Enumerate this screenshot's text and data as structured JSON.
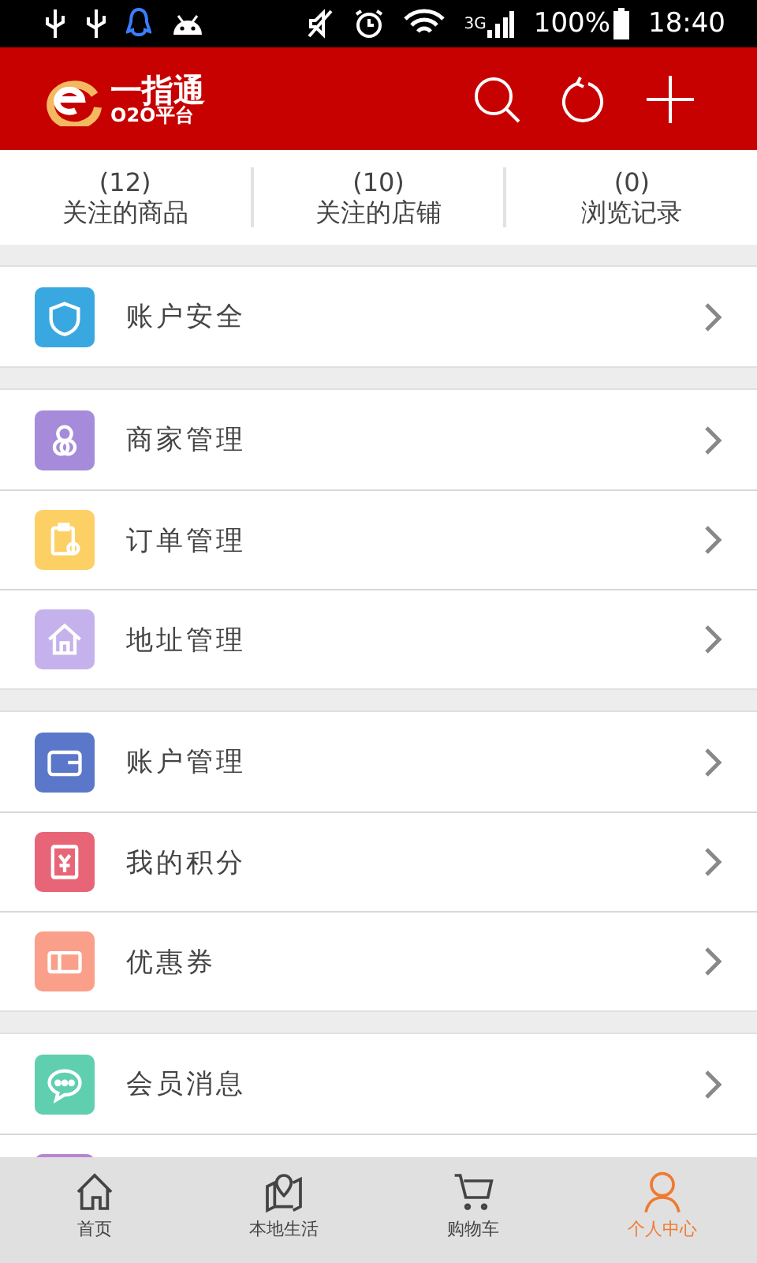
{
  "status_bar": {
    "network": "3G",
    "battery": "100%",
    "time": "18:40"
  },
  "header": {
    "logo_main": "一指通",
    "logo_sub": "O2O平台"
  },
  "stats": [
    {
      "count": "(12)",
      "label": "关注的商品"
    },
    {
      "count": "(10)",
      "label": "关注的店铺"
    },
    {
      "count": "(0)",
      "label": "浏览记录"
    }
  ],
  "groups": [
    [
      {
        "label": "账户安全",
        "color": "#3aa8e0"
      }
    ],
    [
      {
        "label": "商家管理",
        "color": "#a58bd9"
      },
      {
        "label": "订单管理",
        "color": "#fdd066"
      },
      {
        "label": "地址管理",
        "color": "#c5b2ec"
      }
    ],
    [
      {
        "label": "账户管理",
        "color": "#5b77c9"
      },
      {
        "label": "我的积分",
        "color": "#e86577"
      },
      {
        "label": "优惠券",
        "color": "#f99f8a"
      }
    ],
    [
      {
        "label": "会员消息",
        "color": "#5fcfb0"
      },
      {
        "color": "#b785d4"
      }
    ]
  ],
  "nav": [
    {
      "label": "首页",
      "selected": false
    },
    {
      "label": "本地生活",
      "selected": false
    },
    {
      "label": "购物车",
      "selected": false
    },
    {
      "label": "个人中心",
      "selected": true
    }
  ]
}
